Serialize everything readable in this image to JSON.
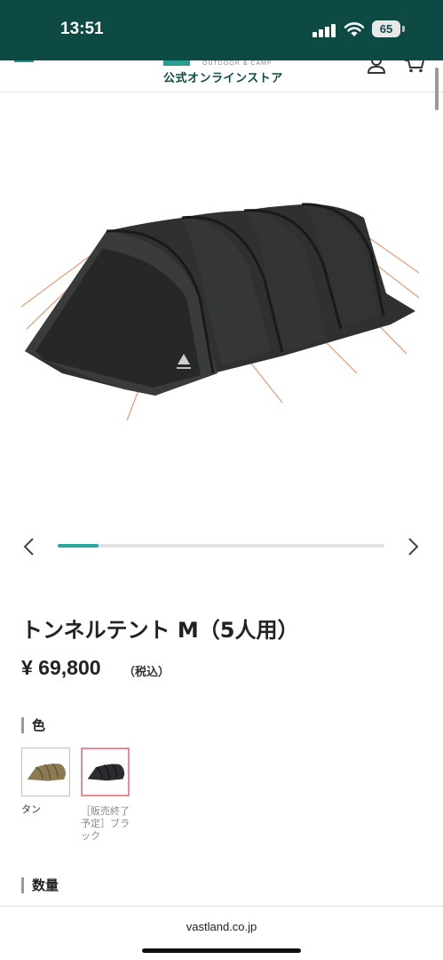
{
  "status_bar": {
    "time": "13:51",
    "battery_level": "65"
  },
  "header": {
    "brand_sub": "OUTDOOR & CAMP",
    "brand_title": "公式オンラインストア",
    "menu_icon": "hamburger-icon",
    "account_icon": "user-icon",
    "cart_icon": "cart-icon"
  },
  "carousel": {
    "progress": 0.125,
    "prev_icon": "chevron-left-icon",
    "next_icon": "chevron-right-icon"
  },
  "product": {
    "title": "トンネルテント M（5人用）",
    "price": "¥ 69,800",
    "tax_note": "（税込）"
  },
  "color_section": {
    "label": "色",
    "options": [
      {
        "caption": "タン",
        "selected": false
      },
      {
        "caption": "［販売終了予定］ブラック",
        "selected": true
      }
    ]
  },
  "quantity_section": {
    "label": "数量"
  },
  "browser": {
    "url": "vastland.co.jp"
  },
  "colors": {
    "brand_dark": "#0e4a44",
    "accent": "#29a89d",
    "selected_border": "#e98c97"
  }
}
